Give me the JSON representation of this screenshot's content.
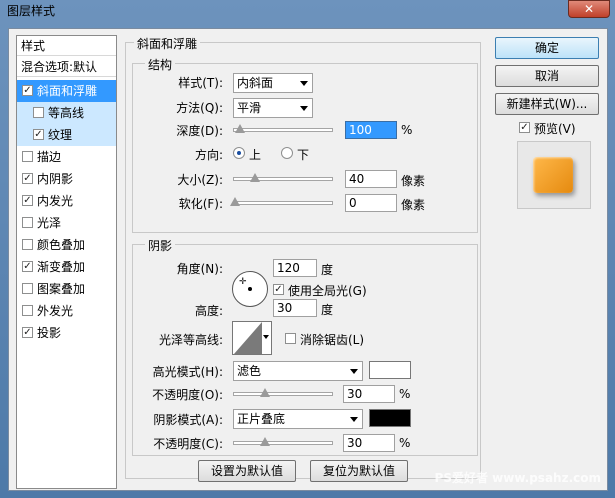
{
  "window": {
    "title": "图层样式",
    "close": "✕"
  },
  "styles_list": {
    "header": "样式",
    "blend_options": "混合选项:默认",
    "items": [
      {
        "label": "斜面和浮雕",
        "checked": true
      },
      {
        "label": "等高线",
        "checked": false
      },
      {
        "label": "纹理",
        "checked": true
      },
      {
        "label": "描边",
        "checked": false
      },
      {
        "label": "内阴影",
        "checked": true
      },
      {
        "label": "内发光",
        "checked": true
      },
      {
        "label": "光泽",
        "checked": false
      },
      {
        "label": "颜色叠加",
        "checked": false
      },
      {
        "label": "渐变叠加",
        "checked": true
      },
      {
        "label": "图案叠加",
        "checked": false
      },
      {
        "label": "外发光",
        "checked": false
      },
      {
        "label": "投影",
        "checked": true
      }
    ]
  },
  "bevel": {
    "group_title": "斜面和浮雕",
    "structure_title": "结构",
    "style_label": "样式(T):",
    "style_value": "内斜面",
    "method_label": "方法(Q):",
    "method_value": "平滑",
    "depth_label": "深度(D):",
    "depth_value": "100",
    "depth_unit": "%",
    "direction_label": "方向:",
    "dir_up": "上",
    "dir_down": "下",
    "size_label": "大小(Z):",
    "size_value": "40",
    "size_unit": "像素",
    "soften_label": "软化(F):",
    "soften_value": "0",
    "soften_unit": "像素"
  },
  "shading": {
    "title": "阴影",
    "angle_label": "角度(N):",
    "angle_value": "120",
    "angle_unit": "度",
    "global_light": "使用全局光(G)",
    "altitude_label": "高度:",
    "altitude_value": "30",
    "altitude_unit": "度",
    "gloss_label": "光泽等高线:",
    "anti_alias": "消除锯齿(L)",
    "highlight_label": "高光模式(H):",
    "highlight_value": "滤色",
    "highlight_color": "#ffffff",
    "opacity1_label": "不透明度(O):",
    "opacity1_value": "30",
    "opacity_unit": "%",
    "shadow_label": "阴影模式(A):",
    "shadow_value": "正片叠底",
    "shadow_color": "#000000",
    "opacity2_label": "不透明度(C):",
    "opacity2_value": "30"
  },
  "footer": {
    "set_default": "设置为默认值",
    "reset_default": "复位为默认值"
  },
  "buttons": {
    "ok": "确定",
    "cancel": "取消",
    "new_style": "新建样式(W)...",
    "preview": "预览(V)"
  },
  "watermark": "PS爱好者 www.psahz.com"
}
